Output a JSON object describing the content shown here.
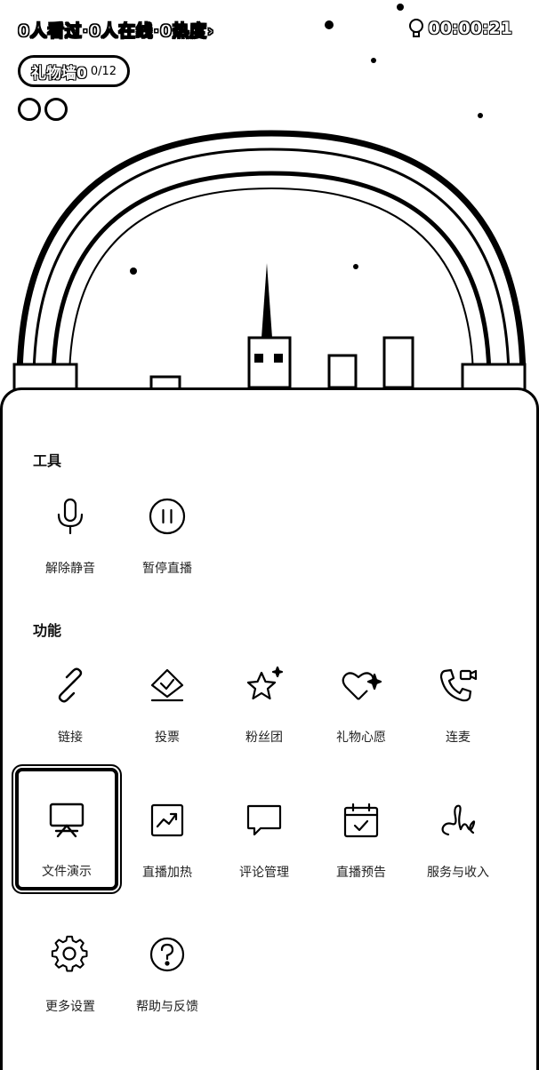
{
  "live": {
    "stats_text": "0人看过·0人在线·0热度›",
    "timer": "00:00:21",
    "gift_wall_label": "礼物墙0",
    "gift_wall_count": "0/12"
  },
  "sheet": {
    "tools_title": "工具",
    "features_title": "功能",
    "tools": [
      {
        "label": "解除静音",
        "icon": "microphone-icon"
      },
      {
        "label": "暂停直播",
        "icon": "pause-icon"
      }
    ],
    "features_row1": [
      {
        "label": "链接",
        "icon": "link-icon"
      },
      {
        "label": "投票",
        "icon": "vote-icon"
      },
      {
        "label": "粉丝团",
        "icon": "star-sparkle-icon"
      },
      {
        "label": "礼物心愿",
        "icon": "heart-sparkle-icon"
      },
      {
        "label": "连麦",
        "icon": "phone-video-icon"
      }
    ],
    "features_row2": [
      {
        "label": "文件演示",
        "icon": "presentation-board-icon"
      },
      {
        "label": "直播加热",
        "icon": "trend-chart-icon"
      },
      {
        "label": "评论管理",
        "icon": "comment-bubble-icon"
      },
      {
        "label": "直播预告",
        "icon": "calendar-check-icon"
      },
      {
        "label": "服务与收入",
        "icon": "signature-icon"
      }
    ],
    "features_row3": [
      {
        "label": "更多设置",
        "icon": "gear-icon"
      },
      {
        "label": "帮助与反馈",
        "icon": "question-icon"
      }
    ]
  }
}
